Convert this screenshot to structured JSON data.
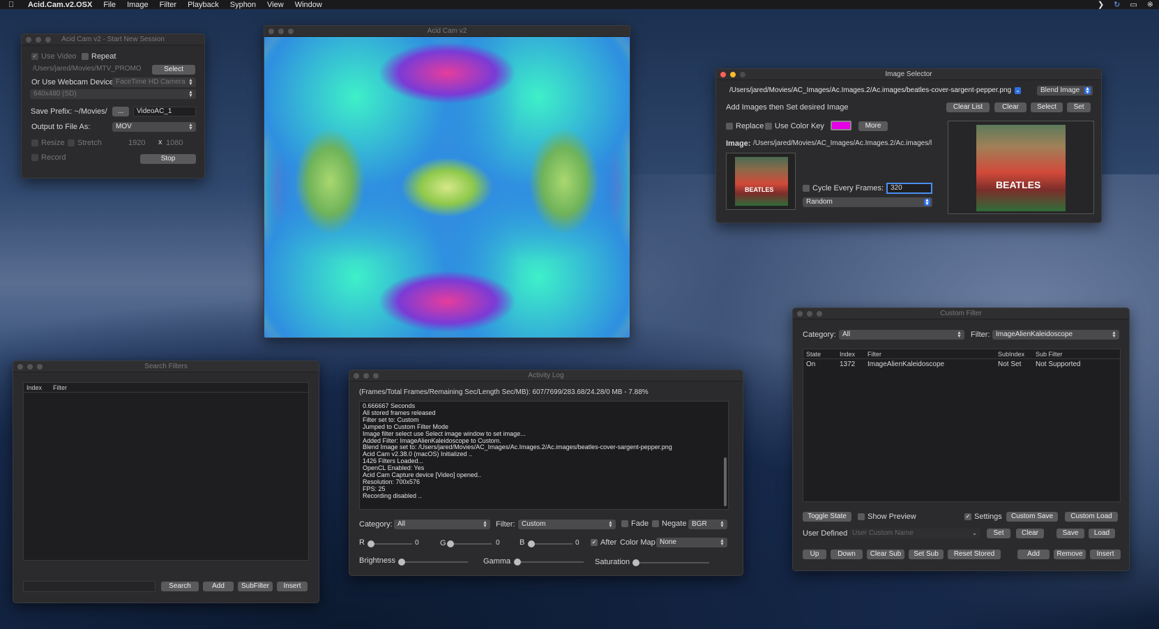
{
  "menubar": {
    "app": "Acid.Cam.v2.OSX",
    "items": [
      "File",
      "Image",
      "Filter",
      "Playback",
      "Syphon",
      "View",
      "Window"
    ],
    "icons": [
      "chevron-right-icon",
      "sync-icon",
      "airplay-icon",
      "bluetooth-icon"
    ]
  },
  "session": {
    "title": "Acid Cam v2 - Start New Session",
    "use_video": "Use Video",
    "repeat": "Repeat",
    "path": "/Users/jared/Movies/MTV_PROMO_E",
    "select": "Select",
    "webcam_label": "Or Use Webcam Device",
    "webcam_value": "FaceTime HD Camera",
    "resolution": "640x480 (SD)",
    "save_prefix_label": "Save Prefix: ~/Movies/",
    "dots": "...",
    "prefix_value": "VideoAC_1",
    "output_label": "Output to File As:",
    "output_value": "MOV",
    "resize": "Resize",
    "stretch": "Stretch",
    "width": "1920",
    "x": "x",
    "height": "1080",
    "record": "Record",
    "stop": "Stop"
  },
  "viewer": {
    "title": "Acid Cam v2"
  },
  "image_selector": {
    "title": "Image Selector",
    "path": "/Users/jared/Movies/AC_Images/Ac.Images.2/Ac.images/beatles-cover-sargent-pepper.png",
    "blend": "Blend Image",
    "hint": "Add Images then Set desired Image",
    "clear_list": "Clear List",
    "clear": "Clear",
    "select": "Select",
    "set": "Set",
    "replace": "Replace",
    "use_color_key": "Use Color Key",
    "color_key": "#e600e6",
    "more": "More",
    "image_label": "Image:",
    "image_path": "/Users/jared/Movies/AC_Images/Ac.Images.2/Ac.images/l",
    "cycle": "Cycle Every Frames:",
    "cycle_value": "320",
    "mode": "Random",
    "thumb_text": "BEATLES"
  },
  "custom_filter": {
    "title": "Custom Filter",
    "category_label": "Category:",
    "category": "All",
    "filter_label": "Filter:",
    "filter": "ImageAlienKaleidoscope",
    "headers": [
      "State",
      "Index",
      "Filter",
      "SubIndex",
      "Sub Filter"
    ],
    "rows": [
      [
        "On",
        "1372",
        "ImageAlienKaleidoscope",
        "Not Set",
        "Not Supported"
      ]
    ],
    "toggle_state": "Toggle State",
    "show_preview": "Show Preview",
    "settings": "Settings",
    "custom_save": "Custom Save",
    "custom_load": "Custom Load",
    "user_defined": "User Defined",
    "user_custom_name": "User Custom Name",
    "set": "Set",
    "clear": "Clear",
    "save": "Save",
    "load": "Load",
    "up": "Up",
    "down": "Down",
    "clear_sub": "Clear Sub",
    "set_sub": "Set Sub",
    "reset_stored": "Reset Stored",
    "add": "Add",
    "remove": "Remove",
    "insert": "Insert"
  },
  "search": {
    "title": "Search Filters",
    "headers": [
      "Index",
      "Filter"
    ],
    "search": "Search",
    "add": "Add",
    "subfilter": "SubFilter",
    "insert": "Insert"
  },
  "log": {
    "title": "Activity Log",
    "status": "(Frames/Total Frames/Remaining Sec/Length Sec/MB): 607/7699/283.68/24.28/0 MB - 7.88%",
    "lines": "0.666667 Seconds\nAll stored frames released\nFilter set to: Custom\nJumped to Custom Filter Mode\nImage filter select use Select image window to set image...\nAdded Filter: ImageAlienKaleidoscope to Custom.\nBlend Image set to: /Users/jared/Movies/AC_Images/Ac.Images.2/Ac.images/beatles-cover-sargent-pepper.png\nAcid Cam v2.38.0 (macOS) Initialized ..\n1426 Filters Loaded...\nOpenCL Enabled: Yes\nAcid Cam Capture device [Video] opened..\nResolution: 700x576\nFPS: 25\nRecording disabled ..",
    "category_label": "Category:",
    "category": "All",
    "filter_label": "Filter:",
    "filter": "Custom",
    "fade": "Fade",
    "negate": "Negate",
    "bgr": "BGR",
    "r": "R",
    "r_val": "0",
    "g": "G",
    "g_val": "0",
    "b": "B",
    "b_val": "0",
    "after": "After",
    "color_map_label": "Color Map",
    "color_map": "None",
    "brightness": "Brightness",
    "gamma": "Gamma",
    "saturation": "Saturation"
  }
}
